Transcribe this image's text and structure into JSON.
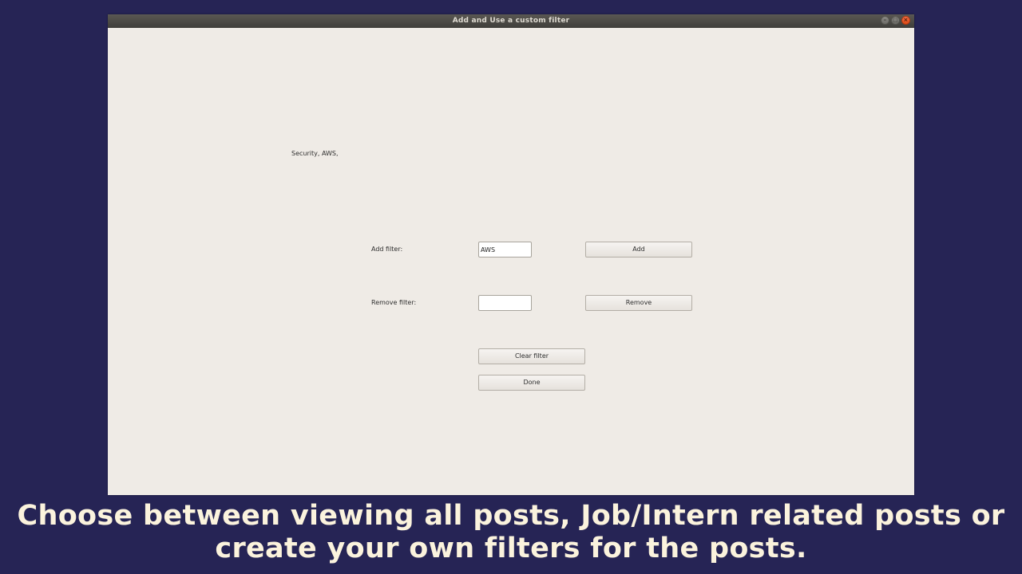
{
  "window": {
    "title": "Add and Use a custom filter",
    "controls": {
      "minimize_icon": "minimize-icon",
      "maximize_icon": "maximize-icon",
      "close_icon": "close-icon"
    }
  },
  "filters_display": "Security, AWS,",
  "add_filter": {
    "label": "Add filter:",
    "value": "AWS",
    "button_label": "Add"
  },
  "remove_filter": {
    "label": "Remove filter:",
    "value": "",
    "button_label": "Remove"
  },
  "clear_button_label": "Clear filter",
  "done_button_label": "Done",
  "caption": "Choose between viewing all posts, Job/Intern related posts or create your own filters for the posts.",
  "colors": {
    "background": "#262455",
    "window": "#efebe6",
    "titlebar": "#3f3e3a",
    "caption_text": "#fbf3dd",
    "close_button": "#df4a16"
  }
}
